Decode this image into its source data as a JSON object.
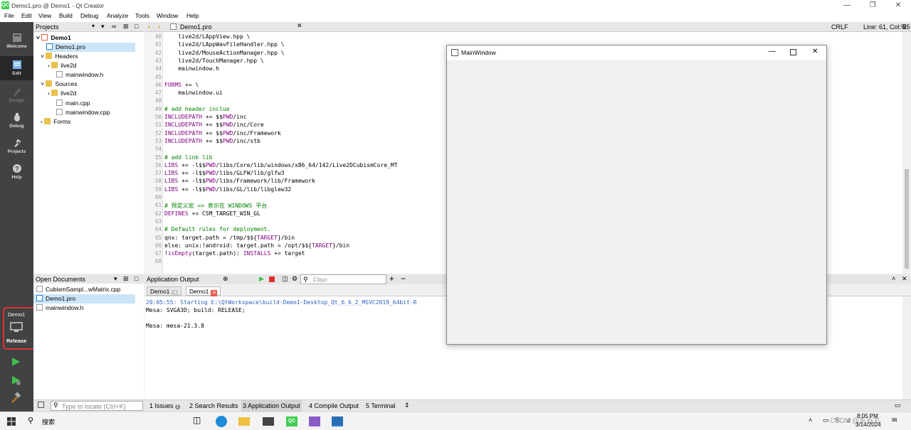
{
  "window": {
    "title": "Demo1.pro @ Demo1 - Qt Creator",
    "logo": "QC"
  },
  "menu": [
    "File",
    "Edit",
    "View",
    "Build",
    "Debug",
    "Analyze",
    "Tools",
    "Window",
    "Help"
  ],
  "modes": [
    {
      "label": "Welcome",
      "icon": "welcome-icon"
    },
    {
      "label": "Edit",
      "icon": "edit-icon"
    },
    {
      "label": "Design",
      "icon": "design-icon"
    },
    {
      "label": "Debug",
      "icon": "debug-icon"
    },
    {
      "label": "Projects",
      "icon": "projects-icon"
    },
    {
      "label": "Help",
      "icon": "help-icon"
    }
  ],
  "kit": {
    "project": "Demo1",
    "config": "Release"
  },
  "projects_panel": {
    "title": "Projects"
  },
  "tree": [
    {
      "label": "Demo1",
      "bold": true
    },
    {
      "label": "Demo1.pro"
    },
    {
      "label": "Headers"
    },
    {
      "label": "live2d"
    },
    {
      "label": "mainwindow.h"
    },
    {
      "label": "Sources"
    },
    {
      "label": "live2d"
    },
    {
      "label": "main.cpp"
    },
    {
      "label": "mainwindow.cpp"
    },
    {
      "label": "Forms"
    }
  ],
  "open_documents": {
    "title": "Open Documents",
    "items": [
      "CubismSampl...wMatrix.cpp",
      "Demo1.pro",
      "mainwindow.h"
    ]
  },
  "editor": {
    "file": "Demo1.pro",
    "line_ending": "CRLF",
    "cursor": "Line: 61, Col: 25"
  },
  "code": [
    {
      "n": "40",
      "t": "    live2d/LAppView.hpp \\"
    },
    {
      "n": "41",
      "t": "    live2d/LAppWavFileHandler.hpp \\"
    },
    {
      "n": "42",
      "t": "    live2d/MouseActionManager.hpp \\"
    },
    {
      "n": "43",
      "t": "    live2d/TouchManager.hpp \\"
    },
    {
      "n": "44",
      "t": "    mainwindow.h"
    },
    {
      "n": "45",
      "t": ""
    },
    {
      "n": "46",
      "t": "FORMS += \\",
      "v": "FORMS"
    },
    {
      "n": "47",
      "t": "    mainwindow.ui"
    },
    {
      "n": "48",
      "t": ""
    },
    {
      "n": "49",
      "t": "# add header inclue",
      "c": true
    },
    {
      "n": "50",
      "t": "INCLUDEPATH += $$PWD/inc",
      "v": "INCLUDEPATH"
    },
    {
      "n": "51",
      "t": "INCLUDEPATH += $$PWD/inc/Core",
      "v": "INCLUDEPATH"
    },
    {
      "n": "52",
      "t": "INCLUDEPATH += $$PWD/inc/Framework",
      "v": "INCLUDEPATH"
    },
    {
      "n": "53",
      "t": "INCLUDEPATH += $$PWD/inc/stb",
      "v": "INCLUDEPATH"
    },
    {
      "n": "54",
      "t": ""
    },
    {
      "n": "55",
      "t": "# add link lib",
      "c": true
    },
    {
      "n": "56",
      "t": "LIBS += -l$$PWD/libs/Core/lib/windows/x86_64/142/Live2DCubismCore_MT",
      "v": "LIBS"
    },
    {
      "n": "57",
      "t": "LIBS += -l$$PWD/libs/GLFW/lib/glfw3",
      "v": "LIBS"
    },
    {
      "n": "58",
      "t": "LIBS += -l$$PWD/libs/Framework/lib/Framework",
      "v": "LIBS"
    },
    {
      "n": "59",
      "t": "LIBS += -l$$PWD/libs/GL/lib/libglew32",
      "v": "LIBS"
    },
    {
      "n": "60",
      "t": ""
    },
    {
      "n": "61",
      "t": "# 预定义宏 => 表示在 WINDOWS 平台",
      "c": true
    },
    {
      "n": "62",
      "t": "DEFINES += CSM_TARGET_WIN_GL",
      "v": "DEFINES"
    },
    {
      "n": "63",
      "t": ""
    },
    {
      "n": "64",
      "t": "# Default rules for deployment.",
      "c": true
    },
    {
      "n": "65",
      "t": "qnx: target.path = /tmp/$${TARGET}/bin"
    },
    {
      "n": "66",
      "t": "else: unix:!android: target.path = /opt/$${TARGET}/bin"
    },
    {
      "n": "67",
      "t": "!isEmpty(target.path): INSTALLS += target"
    },
    {
      "n": "68",
      "t": ""
    }
  ],
  "output": {
    "title": "Application Output",
    "filter_placeholder": "Filter",
    "tabs": [
      "Demo1",
      "Demo1"
    ],
    "lines": [
      {
        "t": "20:05:55: Starting E:\\QtWorkspace\\build-Demo1-Desktop_Qt_6_6_2_MSVC2019_64bit-R",
        "blue": true
      },
      {
        "t": "Mesa: SVGA3D; build: RELEASE;"
      },
      {
        "t": ""
      },
      {
        "t": "Mesa: mesa-21.3.8"
      }
    ]
  },
  "bottom_tabs": [
    "1  Issues",
    "2  Search Results",
    "3  Application Output",
    "4  Compile Output",
    "5  Terminal"
  ],
  "issues_count": "1",
  "locator_placeholder": "Type to locate (Ctrl+K)",
  "mainwindow": {
    "title": "MainWindow"
  },
  "taskbar": {
    "search": "搜索",
    "time": "8:05 PM",
    "date": "3/14/2024",
    "watermark": "CSDN @东谷丸"
  }
}
